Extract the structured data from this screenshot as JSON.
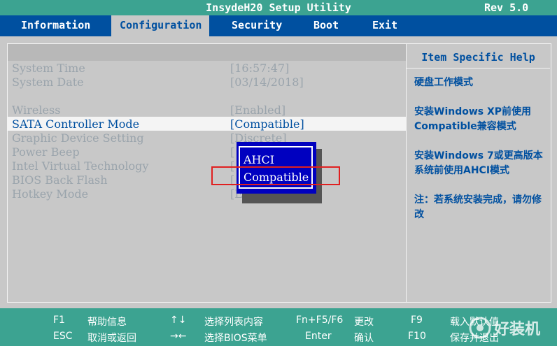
{
  "title": "InsydeH20 Setup Utility",
  "revision": "Rev 5.0",
  "tabs": [
    "Information",
    "Configuration",
    "Security",
    "Boot",
    "Exit"
  ],
  "active_tab": "Configuration",
  "settings": [
    {
      "label": "System Time",
      "value": "[16:57:47]"
    },
    {
      "label": "System Date",
      "value": "[03/14/2018]"
    },
    {
      "label": "Wireless",
      "value": "[Enabled]"
    },
    {
      "label": "SATA Controller Mode",
      "value": "[Compatible]"
    },
    {
      "label": "Graphic Device Setting",
      "value": "[Discrete]"
    },
    {
      "label": "Power Beep",
      "value": "["
    },
    {
      "label": "Intel Virtual Technology",
      "value": "["
    },
    {
      "label": "BIOS Back Flash",
      "value": "["
    },
    {
      "label": "Hotkey Mode",
      "value": "[Enabled]"
    }
  ],
  "popup_options": [
    "AHCI",
    "Compatible"
  ],
  "help": {
    "title": "Item Specific Help",
    "paragraphs": [
      "硬盘工作模式",
      "安装Windows XP前使用Compatible兼容模式",
      "安装Windows 7或更高版本系统前使用AHCI模式",
      "注：若系统安装完成，请勿修改"
    ]
  },
  "footer": {
    "row1": [
      {
        "key": "F1",
        "desc": "帮助信息"
      },
      {
        "key": "↑↓",
        "desc": "选择列表内容"
      },
      {
        "key": "Fn+F5/F6",
        "desc": "更改"
      },
      {
        "key": "F9",
        "desc": "载入默认值"
      }
    ],
    "row2": [
      {
        "key": "ESC",
        "desc": "取消或返回"
      },
      {
        "key": "→←",
        "desc": "选择BIOS菜单"
      },
      {
        "key": "Enter",
        "desc": "确认"
      },
      {
        "key": "F10",
        "desc": "保存并退出"
      }
    ]
  },
  "watermark": "好装机",
  "colors": {
    "title_bar": "#3ca391",
    "menu_bar": "#0050a0",
    "background": "#c8c8c8",
    "popup": "#0000c0",
    "highlight_box": "#e02020"
  }
}
